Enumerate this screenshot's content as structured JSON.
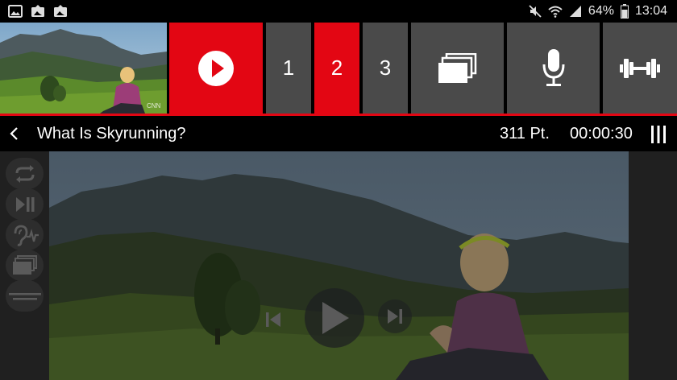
{
  "status_bar": {
    "battery": "64%",
    "time": "13:04",
    "left_icons": [
      "image-icon",
      "photo-upload-icon",
      "photo-upload-icon"
    ],
    "right_icons": [
      "mute-icon",
      "wifi-icon",
      "signal-icon",
      "battery-icon"
    ]
  },
  "tiles": {
    "play_icon": "play-circle-icon",
    "pages": [
      "1",
      "2",
      "3"
    ],
    "active_page": "2",
    "tools": [
      "stacked-cards-icon",
      "microphone-icon",
      "dumbbell-icon"
    ]
  },
  "header": {
    "title": "What Is Skyrunning?",
    "points": "311 Pt.",
    "timer": "00:00:30"
  },
  "sidebar": {
    "buttons": [
      "repeat-icon",
      "play-pause-icon",
      "listen-icon",
      "stacked-cards-icon",
      "subtitles-icon"
    ]
  },
  "player": {
    "controls": [
      "skip-previous-icon",
      "play-icon",
      "skip-next-icon"
    ]
  },
  "colors": {
    "accent": "#e30613",
    "tile": "#4a4a4a",
    "panel": "#202020"
  }
}
